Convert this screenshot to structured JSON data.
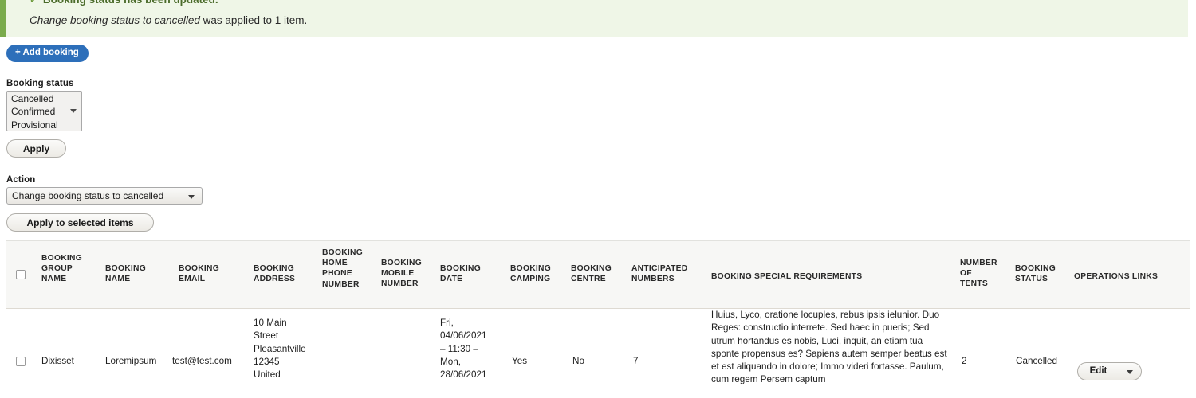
{
  "message": {
    "check_icon": "check-icon",
    "title": "Booking status has been updated.",
    "action_name": "Change booking status to cancelled",
    "detail_suffix": " was applied to 1 item."
  },
  "toolbar": {
    "add_booking_label": "+ Add booking"
  },
  "filters": {
    "booking_status_label": "Booking status",
    "booking_status_options": [
      "Cancelled",
      "Confirmed",
      "Provisional"
    ],
    "apply_label": "Apply"
  },
  "actions": {
    "action_label": "Action",
    "selected_action": "Change booking status to cancelled",
    "apply_to_selected_label": "Apply to selected items"
  },
  "table": {
    "select_all_name": "select-all-checkbox",
    "columns": [
      "BOOKING GROUP NAME",
      "BOOKING NAME",
      "BOOKING EMAIL",
      "BOOKING ADDRESS",
      "BOOKING HOME PHONE NUMBER",
      "BOOKING MOBILE NUMBER",
      "BOOKING DATE",
      "BOOKING CAMPING",
      "BOOKING CENTRE",
      "ANTICIPATED NUMBERS",
      "BOOKING SPECIAL REQUIREMENTS",
      "NUMBER OF TENTS",
      "BOOKING STATUS",
      "OPERATIONS LINKS"
    ],
    "rows": [
      {
        "group_name": "Dixisset",
        "name": "Loremipsum",
        "email": "test@test.com",
        "address": "10 Main Street Pleasantville 12345 United",
        "home_phone": "",
        "mobile": "",
        "date": "Fri, 04/06/2021 – 11:30 – Mon, 28/06/2021",
        "camping": "Yes",
        "centre": "No",
        "anticipated_numbers": "7",
        "special_requirements": "Huius, Lyco, oratione locuples, rebus ipsis ielunior. Duo Reges: constructio interrete. Sed haec in pueris; Sed utrum hortandus es nobis, Luci, inquit, an etiam tua sponte propensus es? Sapiens autem semper beatus est et est aliquando in dolore; Immo videri fortasse. Paulum, cum regem Persem captum",
        "number_of_tents": "2",
        "status": "Cancelled",
        "edit_label": "Edit"
      }
    ]
  },
  "colors": {
    "accent_blue": "#2d6fba",
    "success_green": "#7aab4c",
    "success_bg": "#eff6e7",
    "header_bg": "#f7f7f5"
  }
}
